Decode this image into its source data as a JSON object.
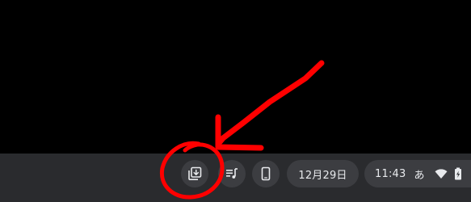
{
  "shelf": {
    "date_label": "12月29日",
    "time_label": "11:43",
    "ime_label": "あ",
    "icons": {
      "tote": "holding-space-icon",
      "media": "media-controls-icon",
      "phone": "phone-hub-icon",
      "wifi": "wifi-icon",
      "battery": "battery-charging-icon"
    }
  },
  "colors": {
    "shelf_background": "#2a2b2e",
    "button_background": "#3c3d41",
    "icon_color": "#e8eaed",
    "annotation_color": "#ff0000"
  }
}
